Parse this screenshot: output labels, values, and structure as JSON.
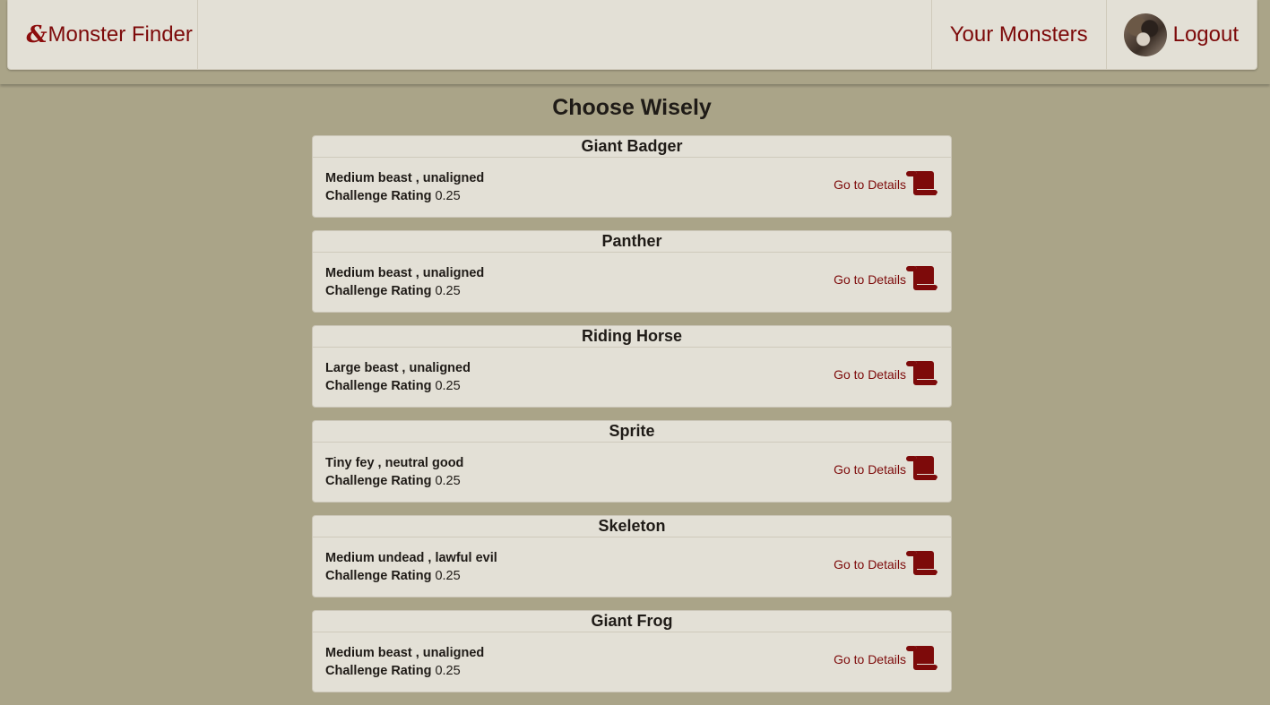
{
  "nav": {
    "brand_icon": "&",
    "brand_label": "Monster Finder",
    "your_monsters": "Your Monsters",
    "logout": "Logout"
  },
  "page": {
    "title": "Choose Wisely"
  },
  "labels": {
    "challenge_rating": "Challenge Rating",
    "go_to_details": "Go to Details"
  },
  "monsters": [
    {
      "name": "Giant Badger",
      "type": "Medium beast , unaligned",
      "cr": "0.25"
    },
    {
      "name": "Panther",
      "type": "Medium beast , unaligned",
      "cr": "0.25"
    },
    {
      "name": "Riding Horse",
      "type": "Large beast , unaligned",
      "cr": "0.25"
    },
    {
      "name": "Sprite",
      "type": "Tiny fey , neutral good",
      "cr": "0.25"
    },
    {
      "name": "Skeleton",
      "type": "Medium undead , lawful evil",
      "cr": "0.25"
    },
    {
      "name": "Giant Frog",
      "type": "Medium beast , unaligned",
      "cr": "0.25"
    }
  ],
  "colors": {
    "accent": "#7d0a0a",
    "background": "#aaa488",
    "panel": "#e3e0d6"
  },
  "icons": {
    "brand": "dnd-ampersand-icon",
    "details": "scroll-icon"
  }
}
